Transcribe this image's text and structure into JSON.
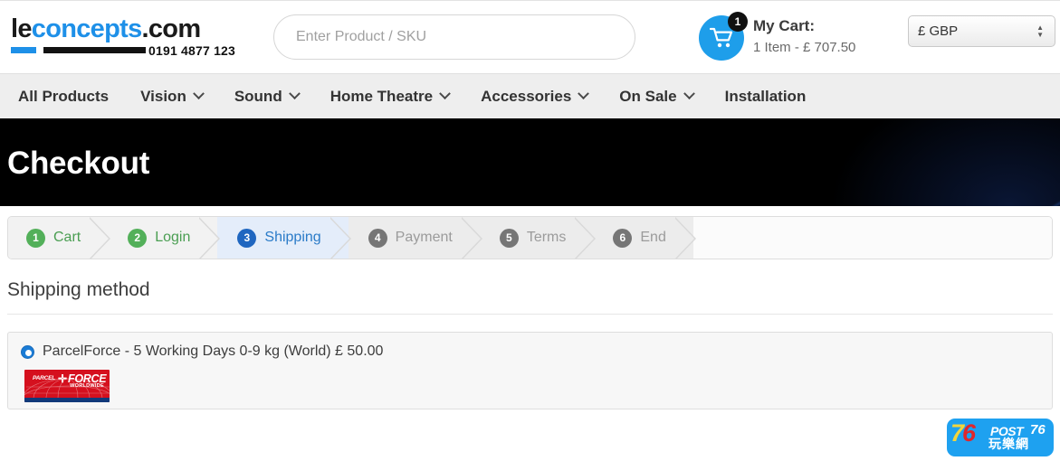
{
  "header": {
    "logo": {
      "part1": "le",
      "part2": "concepts",
      "part3": ".com",
      "phone": "0191 4877 123"
    },
    "search": {
      "placeholder": "Enter Product / SKU",
      "value": ""
    },
    "cart": {
      "badge": "1",
      "title": "My Cart:",
      "summary": "1 Item - £ 707.50"
    },
    "currency": {
      "selected": "£ GBP",
      "options": [
        "£ GBP"
      ]
    }
  },
  "nav": {
    "items": [
      {
        "label": "All Products",
        "has_caret": false
      },
      {
        "label": "Vision",
        "has_caret": true
      },
      {
        "label": "Sound",
        "has_caret": true
      },
      {
        "label": "Home Theatre",
        "has_caret": true
      },
      {
        "label": "Accessories",
        "has_caret": true
      },
      {
        "label": "On Sale",
        "has_caret": true
      },
      {
        "label": "Installation",
        "has_caret": false
      }
    ]
  },
  "banner": {
    "title": "Checkout"
  },
  "steps": [
    {
      "num": "1",
      "label": "Cart",
      "state": "done"
    },
    {
      "num": "2",
      "label": "Login",
      "state": "done"
    },
    {
      "num": "3",
      "label": "Shipping",
      "state": "active"
    },
    {
      "num": "4",
      "label": "Payment",
      "state": "todo"
    },
    {
      "num": "5",
      "label": "Terms",
      "state": "todo"
    },
    {
      "num": "6",
      "label": "End",
      "state": "todo"
    }
  ],
  "main": {
    "section_title": "Shipping method",
    "shipping_options": [
      {
        "label": "ParcelForce - 5 Working Days 0-9 kg (World) £ 50.00",
        "selected": true,
        "logo": {
          "parcel": "PARCEL",
          "force": "FORCE",
          "worldwide": "WORLDWIDE"
        }
      }
    ]
  },
  "watermark": {
    "num_7": "7",
    "num_6": "6",
    "post": "POST",
    "num_76": "76",
    "chinese": "玩樂網"
  },
  "colors": {
    "brand_blue": "#1e90e8",
    "cart_blue": "#1e9eea",
    "step_done_green": "#53b05a",
    "step_active_blue": "#1f66c0",
    "step_todo_gray": "#767676",
    "banner_black": "#000000",
    "nav_gray": "#eeeeee",
    "parcelforce_red": "#d5101e"
  }
}
